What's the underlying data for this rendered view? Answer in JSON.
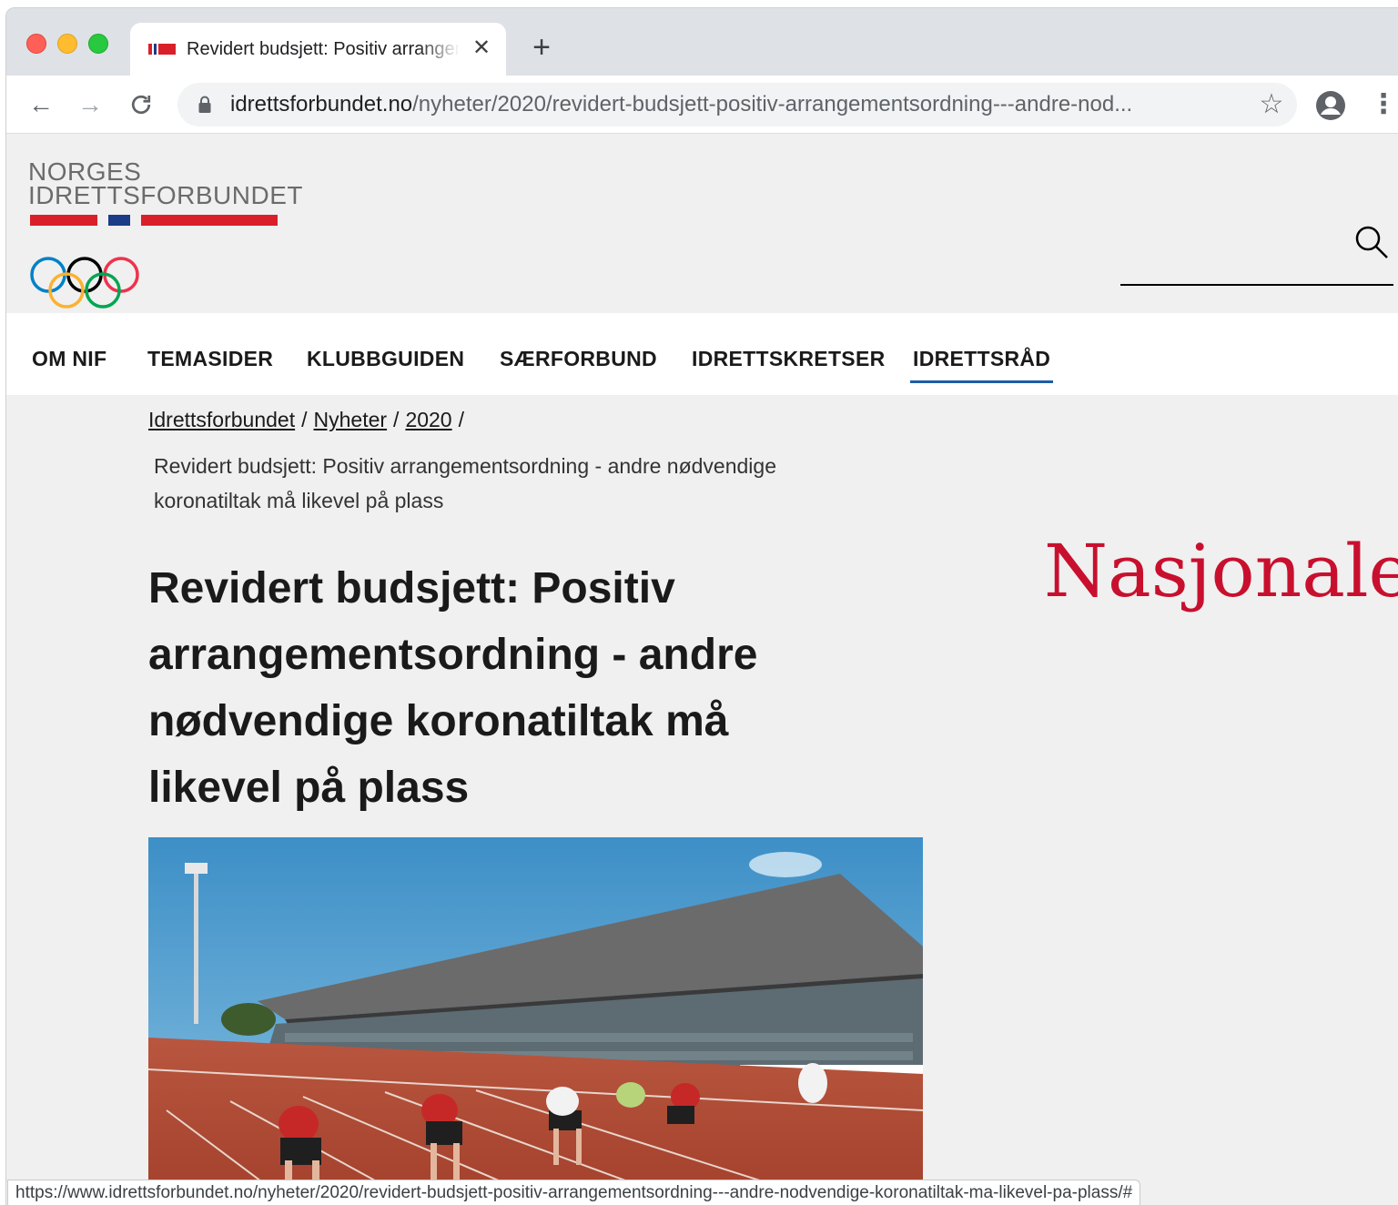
{
  "browser": {
    "tab": {
      "title": "Revidert budsjett: Positiv arrangementsordning - andre nødvendige koronatiltak må likevel på plass",
      "close_glyph": "✕"
    },
    "new_tab_glyph": "+",
    "nav": {
      "back": "←",
      "forward": "→",
      "reload": "C"
    },
    "address": {
      "host": "idrettsforbundet.no",
      "path": "/nyheter/2020/revidert-budsjett-positiv-arrangementsordning---andre-nod..."
    },
    "star_glyph": "☆",
    "menu_glyph": "⋮",
    "status_url": "https://www.idrettsforbundet.no/nyheter/2020/revidert-budsjett-positiv-arrangementsordning---andre-nodvendige-koronatiltak-ma-likevel-pa-plass/#"
  },
  "site": {
    "logo": {
      "line1": "NORGES",
      "line2": "IDRETTSFORBUNDET"
    },
    "colors": {
      "red": "#d9202a",
      "blue": "#1b3c87",
      "nav_underline": "#1e5ca8",
      "accent_title": "#c8102e"
    },
    "nav": [
      {
        "label": "OM NIF"
      },
      {
        "label": "TEMASIDER"
      },
      {
        "label": "KLUBBGUIDEN"
      },
      {
        "label": "SÆRFORBUND"
      },
      {
        "label": "IDRETTSKRETSER"
      },
      {
        "label": "IDRETTSRÅD",
        "active": true
      }
    ],
    "breadcrumb": [
      {
        "label": "Idrettsforbundet"
      },
      {
        "label": "Nyheter"
      },
      {
        "label": "2020"
      }
    ],
    "breadcrumb_separator": "/",
    "current_page": "Revidert budsjett: Positiv arrangementsordning - andre nødvendige koronatiltak må likevel på plass",
    "headline": "Revidert budsjett: Positiv arrangementsordning - andre nødvendige koronatiltak må likevel på plass",
    "side_title": "Nasjonale"
  }
}
